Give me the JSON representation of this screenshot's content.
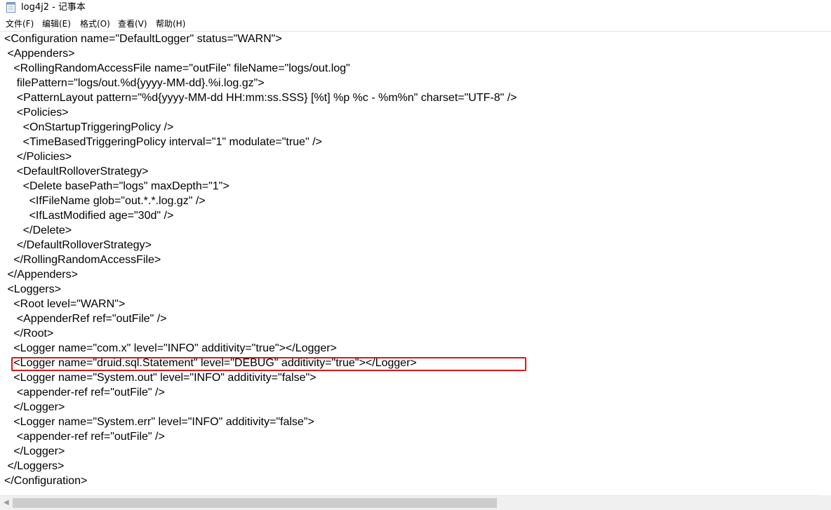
{
  "window": {
    "title": "log4j2 - 记事本"
  },
  "menu": [
    {
      "label": "文件(F)"
    },
    {
      "label": "编辑(E)"
    },
    {
      "label": "格式(O)"
    },
    {
      "label": "查看(V)"
    },
    {
      "label": "帮助(H)"
    }
  ],
  "editor": {
    "lines": [
      "<Configuration name=\"DefaultLogger\" status=\"WARN\">",
      " <Appenders>",
      "   <RollingRandomAccessFile name=\"outFile\" fileName=\"logs/out.log\"",
      "    filePattern=\"logs/out.%d{yyyy-MM-dd}.%i.log.gz\">",
      "    <PatternLayout pattern=\"%d{yyyy-MM-dd HH:mm:ss.SSS} [%t] %p %c - %m%n\" charset=\"UTF-8\" />",
      "    <Policies>",
      "      <OnStartupTriggeringPolicy />",
      "      <TimeBasedTriggeringPolicy interval=\"1\" modulate=\"true\" />",
      "    </Policies>",
      "    <DefaultRolloverStrategy>",
      "      <Delete basePath=\"logs\" maxDepth=\"1\">",
      "        <IfFileName glob=\"out.*.*.log.gz\" />",
      "        <IfLastModified age=\"30d\" />",
      "      </Delete>",
      "    </DefaultRolloverStrategy>",
      "   </RollingRandomAccessFile>",
      " </Appenders>",
      " <Loggers>",
      "   <Root level=\"WARN\">",
      "    <AppenderRef ref=\"outFile\" />",
      "   </Root>",
      "   <Logger name=\"com.x\" level=\"INFO\" additivity=\"true\"></Logger>",
      "   <Logger name=\"druid.sql.Statement\" level=\"DEBUG\" additivity=\"true\"></Logger>",
      "   <Logger name=\"System.out\" level=\"INFO\" additivity=\"false\">",
      "    <appender-ref ref=\"outFile\" />",
      "   </Logger>",
      "   <Logger name=\"System.err\" level=\"INFO\" additivity=\"false\">",
      "    <appender-ref ref=\"outFile\" />",
      "   </Logger>",
      " </Loggers>",
      "</Configuration>"
    ]
  },
  "highlight": {
    "color": "#e0141e"
  },
  "icons": {
    "app": "notepad-icon",
    "scroll_left": "scroll-left-arrow-icon"
  }
}
